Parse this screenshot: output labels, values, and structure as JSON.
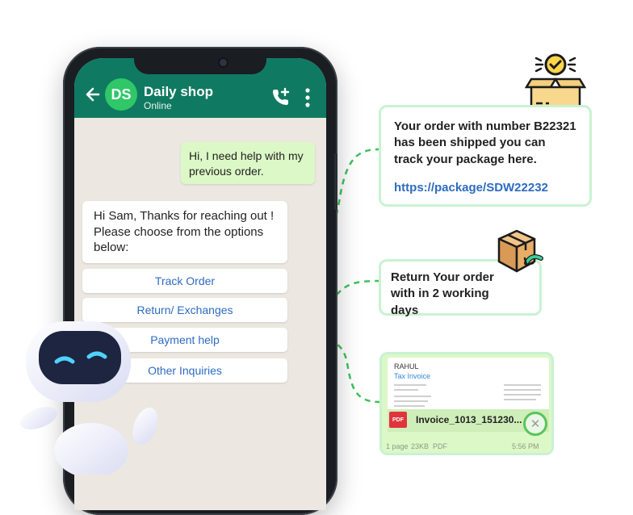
{
  "chat": {
    "contact_name": "Daily shop",
    "contact_status": "Online",
    "avatar_initials": "DS"
  },
  "messages": {
    "outgoing": "Hi, I need help with my previous order.",
    "incoming": "Hi Sam, Thanks for reaching out ! Please choose from the options below:"
  },
  "options": [
    {
      "label": "Track Order"
    },
    {
      "label": "Return/ Exchanges"
    },
    {
      "label": "Payment help"
    },
    {
      "label": "Other Inquiries"
    }
  ],
  "cards": {
    "tracking": {
      "text": "Your order with number B22321 has been shipped you can track your package here.",
      "link": "https://package/SDW22232"
    },
    "returns": {
      "text": "Return Your order with in 2 working days"
    },
    "invoice": {
      "recipient": "RAHUL",
      "doc_title": "Tax Invoice",
      "file_badge": "PDF",
      "file_name": "Invoice_1013_151230...",
      "pages": "1 page",
      "size": "23KB",
      "type": "PDF",
      "time": "5:56 PM"
    }
  },
  "colors": {
    "header_green": "#0f7a61",
    "avatar_green": "#2fc767",
    "link_blue": "#2d6cc0",
    "bubble_out": "#dcf8c6",
    "connector_green": "#3cc25c"
  }
}
